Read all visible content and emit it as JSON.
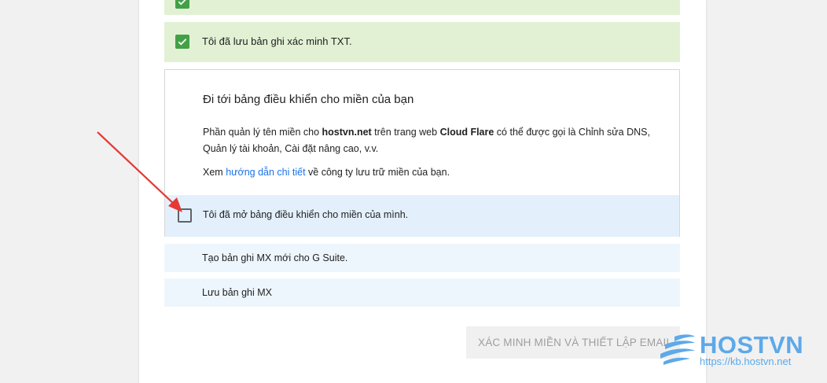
{
  "steps": {
    "done_top": {
      "label": ""
    },
    "done_txt": {
      "label": "Tôi đã lưu bản ghi xác minh TXT."
    },
    "active": {
      "heading": "Đi tới bảng điều khiển cho miền của bạn",
      "desc_prefix": "Phần quản lý tên miền cho ",
      "domain": "hostvn.net",
      "desc_middle": " trên trang web ",
      "registrar": "Cloud Flare",
      "desc_suffix": " có thể được gọi là Chỉnh sửa DNS, Quản lý tài khoản, Cài đặt nâng cao, v.v.",
      "guide_prefix": "Xem ",
      "guide_link": "hướng dẫn chi tiết",
      "guide_suffix": " về công ty lưu trữ miền của bạn.",
      "confirm_label": "Tôi đã mở bảng điều khiển cho miền của mình."
    },
    "pending_mx_create": {
      "label": "Tạo bản ghi MX mới cho G Suite."
    },
    "pending_mx_save": {
      "label": "Lưu bản ghi MX"
    }
  },
  "actions": {
    "verify_label": "XÁC MINH MIỀN VÀ THIẾT LẬP EMAIL"
  },
  "watermark": {
    "brand": "HOSTVN",
    "url": "https://kb.hostvn.net"
  },
  "colors": {
    "done_bg": "#e2f1d4",
    "check_green": "#43a047",
    "active_row_bg": "#e3f0fb",
    "pending_bg": "#eef6fd",
    "link": "#1a73e8",
    "arrow": "#e53935",
    "watermark": "#5da9e9"
  }
}
